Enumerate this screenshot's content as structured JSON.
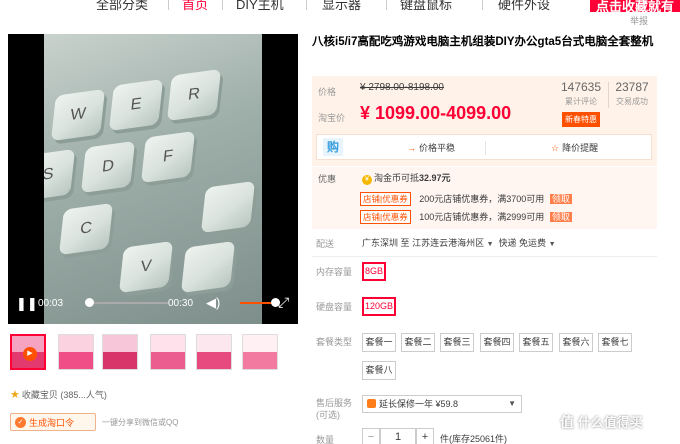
{
  "topnav": {
    "items": [
      "全部分类",
      "首页",
      "DIY主机",
      "显示器",
      "键盘鼠标",
      "硬件外设"
    ],
    "promo": "点击收藏就有",
    "report": "举报"
  },
  "video": {
    "current_time": "00:03",
    "duration": "00:30",
    "progress": 0.1,
    "volume": 1.0,
    "keys": [
      "W",
      "E",
      "R",
      "D",
      "F",
      "C",
      "V",
      "S"
    ]
  },
  "gallery": {
    "thumb_count": 6,
    "selected_index": 0
  },
  "favorite": {
    "label": "收藏宝贝",
    "count": "(385...人气)"
  },
  "tpwd_button": "生成淘口令",
  "share_text": "一键分享到微信或QQ",
  "product": {
    "title": "八核i5/i7高配吃鸡游戏电脑主机组装DIY办公gta5台式电脑全套整机"
  },
  "price": {
    "label": "价格",
    "original": "¥ 2798.00-8198.00",
    "taobao_label": "淘宝价",
    "current": "¥ 1099.00-4099.00",
    "tag": "新春特惠",
    "reviews_count": "147635",
    "reviews_label": "累计评论",
    "sales_count": "23787",
    "sales_label": "交易成功",
    "gou": "购",
    "trend_label": "价格平稳",
    "alert_label": "降价提醒"
  },
  "promo": {
    "label": "优惠",
    "coin_text": "淘金币可抵",
    "coin_amount": "32.97元",
    "coupons": [
      {
        "tag": "店铺",
        "tag_sub": "优惠券",
        "text": "200元店铺优惠券，满3700可用",
        "get": "领取"
      },
      {
        "tag": "店铺",
        "tag_sub": "优惠券",
        "text": "100元店铺优惠券，满2999可用",
        "get": "领取"
      }
    ]
  },
  "shipping": {
    "label": "配送",
    "from": "广东深圳",
    "to_word": "至",
    "to": "江苏连云港海州区",
    "method": "快递 免运费"
  },
  "memory": {
    "label": "内存容量",
    "options": [
      "8GB"
    ],
    "selected": "8GB"
  },
  "disk": {
    "label": "硬盘容量",
    "options": [
      "120GB"
    ],
    "selected": "120GB"
  },
  "packages": {
    "label": "套餐类型",
    "options": [
      "套餐一",
      "套餐二",
      "套餐三",
      "套餐四",
      "套餐五",
      "套餐六",
      "套餐七",
      "套餐八"
    ]
  },
  "service": {
    "label": "售后服务",
    "sublabel": "(可选)",
    "value": "延长保修一年 ¥59.8"
  },
  "quantity": {
    "label": "数量",
    "minus": "−",
    "value": "1",
    "plus": "+",
    "stock": "件(库存25061件)"
  },
  "watermark": "什么值得买",
  "colors": {
    "accent_red": "#ff0036",
    "accent_orange": "#ff5000",
    "price_bg": "#fff2e8"
  }
}
